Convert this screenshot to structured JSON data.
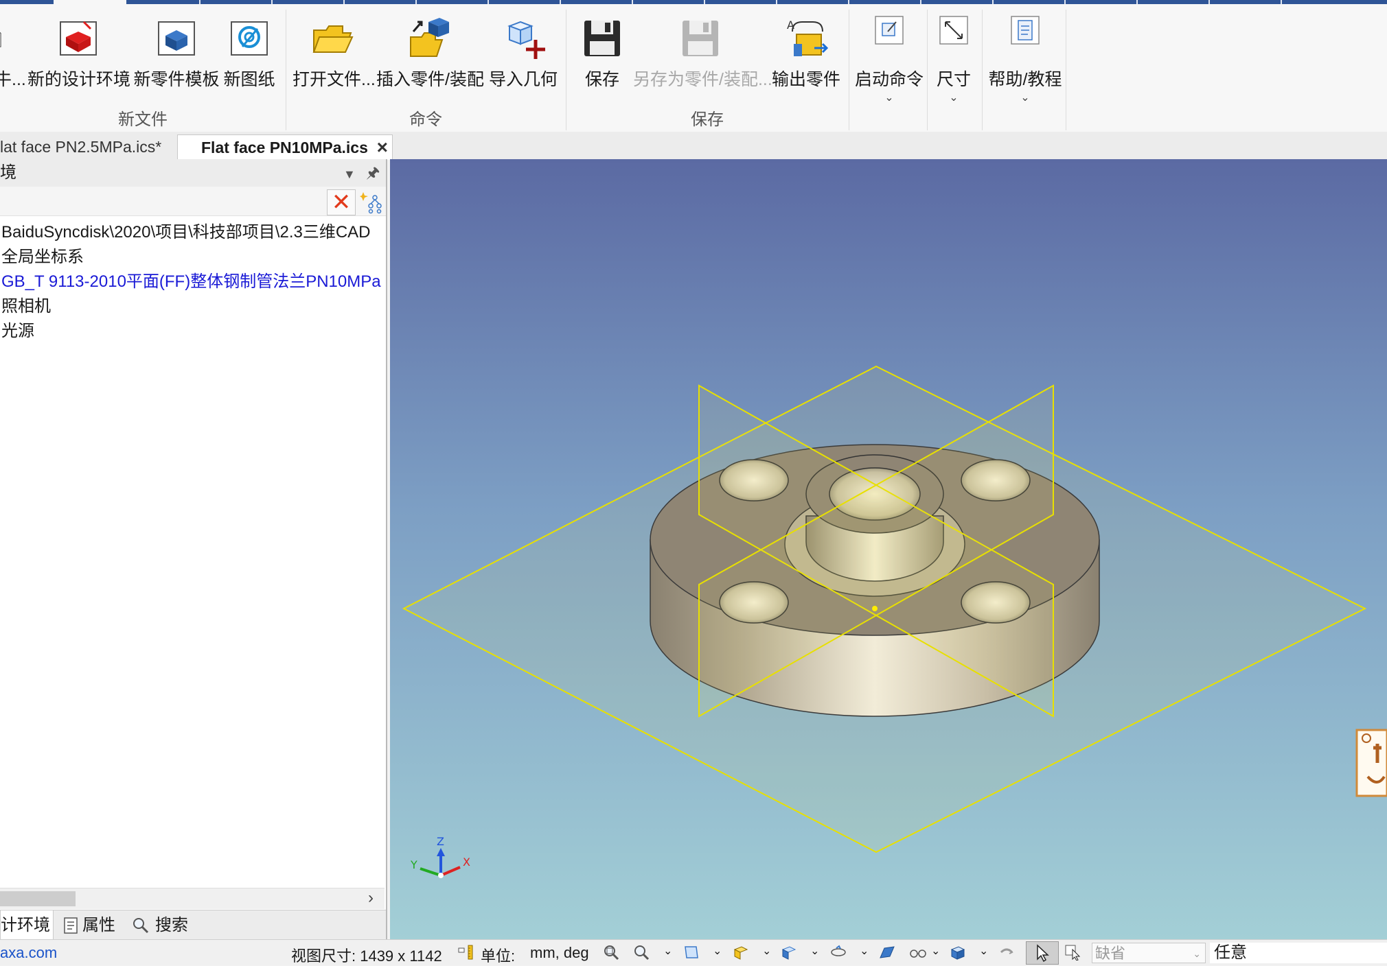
{
  "ribbon": {
    "groups": {
      "new_file": "新文件",
      "command": "命令",
      "save": "保存"
    },
    "buttons": {
      "new_file_truncated": "牛...",
      "new_design_env": "新的设计环境",
      "new_part_template": "新零件模板",
      "new_drawing": "新图纸",
      "open_file": "打开文件...",
      "insert_part": "插入零件/装配",
      "import_geometry": "导入几何",
      "save": "保存",
      "save_as_part": "另存为零件/装配...",
      "export_part": "输出零件",
      "start_command": "启动命令",
      "dimension": "尺寸",
      "help": "帮助/教程"
    }
  },
  "doc_tabs": [
    {
      "label": "lat face PN2.5MPa.ics*"
    },
    {
      "label": "Flat face PN10MPa.ics"
    }
  ],
  "panel": {
    "title": "境",
    "tree": [
      "BaiduSyncdisk\\2020\\项目\\科技部项目\\2.3三维CAD",
      "全局坐标系",
      "GB_T 9113-2010平面(FF)整体钢制管法兰PN10MPa",
      "照相机",
      "光源"
    ],
    "bottom_tabs": [
      "计环境",
      "属性",
      "搜索"
    ]
  },
  "axes": {
    "z": "Z",
    "y": "Y",
    "x": "X"
  },
  "status": {
    "website": "axa.com",
    "view_size": "视图尺寸: 1439 x 1142",
    "unit_label": "单位:",
    "unit_value": "mm, deg",
    "default_combo": "缺省",
    "filter_value": "任意"
  }
}
